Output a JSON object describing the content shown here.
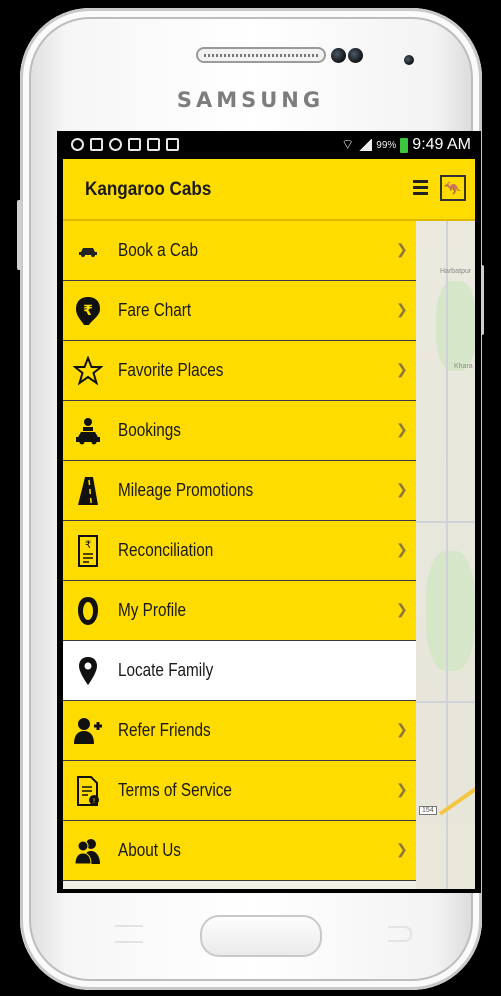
{
  "device": {
    "brand": "SAMSUNG"
  },
  "status_bar": {
    "battery_percent": "99%",
    "time": "9:49 AM"
  },
  "app": {
    "title": "Kangaroo Cabs"
  },
  "menu": {
    "items": [
      {
        "label": "Book a Cab",
        "icon": "car-icon",
        "active": false
      },
      {
        "label": "Fare Chart",
        "icon": "rupee-icon",
        "active": false
      },
      {
        "label": "Favorite Places",
        "icon": "star-icon",
        "active": false
      },
      {
        "label": "Bookings",
        "icon": "passenger-car-icon",
        "active": false
      },
      {
        "label": "Mileage Promotions",
        "icon": "road-icon",
        "active": false
      },
      {
        "label": "Reconciliation",
        "icon": "receipt-icon",
        "active": false
      },
      {
        "label": "My Profile",
        "icon": "profile-icon",
        "active": false
      },
      {
        "label": "Locate Family",
        "icon": "map-pin-icon",
        "active": true
      },
      {
        "label": "Refer Friends",
        "icon": "add-person-icon",
        "active": false
      },
      {
        "label": "Terms of Service",
        "icon": "document-icon",
        "active": false
      },
      {
        "label": "About Us",
        "icon": "people-icon",
        "active": false
      }
    ]
  },
  "map": {
    "labels": [
      "Harbatpur",
      "Khara"
    ],
    "shield": "154"
  },
  "colors": {
    "accent": "#ffdc00",
    "active_row": "#ffffff",
    "divider": "#3a3a3a"
  }
}
